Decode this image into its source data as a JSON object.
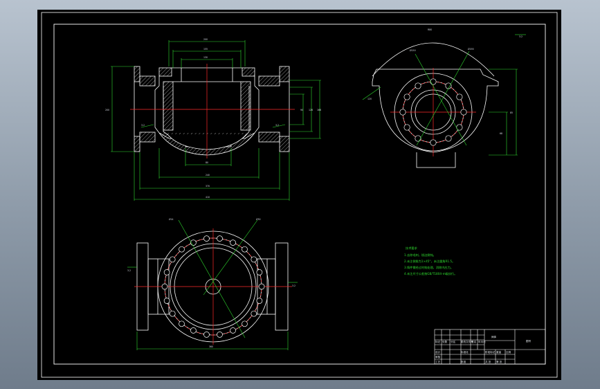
{
  "drawing": {
    "background": "#000000",
    "colors": {
      "outline": "#ffffff",
      "dimension": "#2fdc2f",
      "centerline": "#ff2a2a",
      "bolt_hole": "#ff2a2a",
      "hatch": "#ffffff"
    }
  },
  "views": {
    "front_section": {
      "dims_top": [
        "200",
        "155",
        "130"
      ],
      "dim_left": "200",
      "dims_right": [
        "90",
        "128",
        "168"
      ],
      "dims_bottom": [
        "80",
        "240",
        "370",
        "410"
      ],
      "roughness": [
        "3.2",
        "3.2"
      ]
    },
    "side_view": {
      "dims": [
        "Ø150",
        "Ø190",
        "R80",
        "68",
        "85",
        "120"
      ],
      "roughness": "3.2"
    },
    "top_view": {
      "dims": [
        "Ø14",
        "Ø30",
        "360"
      ],
      "roughness_left": "3.2",
      "roughness_right": "3.2"
    }
  },
  "notes": {
    "title": "技术要求",
    "lines": [
      "1.去除毛刺，锐边倒钝。",
      "2.未注倒角为1×45°，未注圆角R1.5。",
      "3.铸件需经过时效处理，消除内应力。",
      "4.未注尺寸公差按GB/T1804-m级执行。"
    ]
  },
  "title_block": {
    "part_name": "阀体",
    "drawing_no": "图号",
    "cells": [
      "标记",
      "处数",
      "分区",
      "更改文件号",
      "签名",
      "年月日",
      "设计",
      "标准化",
      "阶段标记",
      "重量",
      "比例",
      "审核",
      "工艺",
      "批准",
      "共 张",
      "第 张"
    ]
  }
}
